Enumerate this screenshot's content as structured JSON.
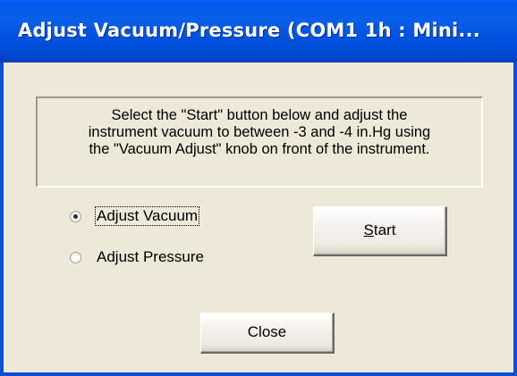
{
  "window": {
    "title": "Adjust Vacuum/Pressure (COM1 1h : Mini...",
    "colors": {
      "titlebar": "#0053e0",
      "face": "#ece9d8",
      "text": "#000000"
    }
  },
  "instructions": {
    "lines": [
      "Select the \"Start\" button below and adjust the",
      "instrument vacuum to between -3 and -4 in.Hg using",
      "the \"Vacuum Adjust\" knob on front of the instrument."
    ]
  },
  "mode": {
    "options": [
      {
        "label": "Adjust Vacuum",
        "checked": true
      },
      {
        "label": "Adjust Pressure",
        "checked": false
      }
    ]
  },
  "buttons": {
    "start": {
      "mnemonic": "S",
      "rest": "tart"
    },
    "close": {
      "label": "Close"
    }
  }
}
